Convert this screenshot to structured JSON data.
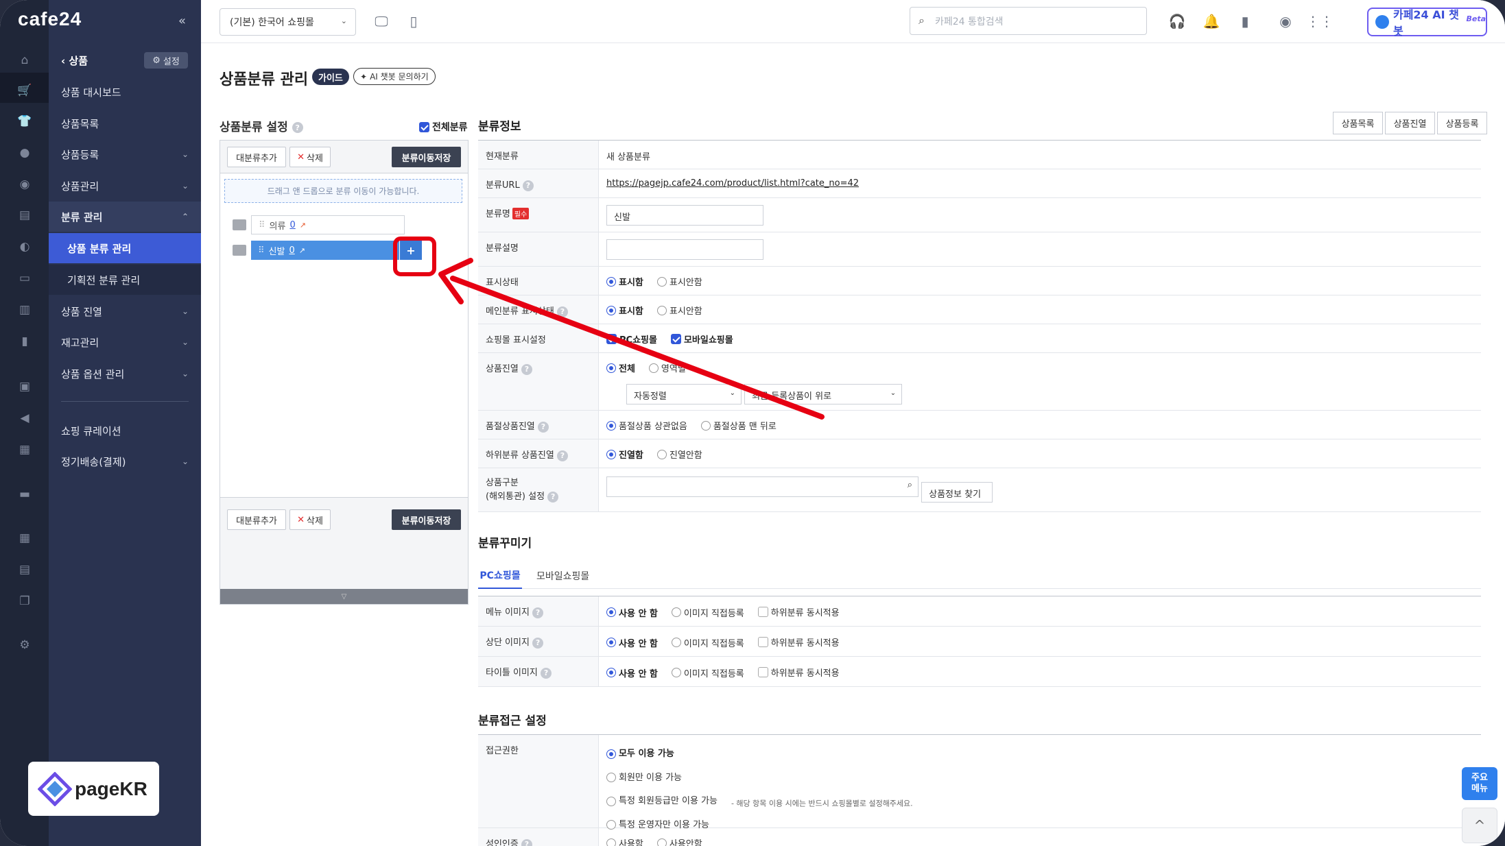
{
  "app": {
    "logo": "cafe24",
    "collapse": "«"
  },
  "rail": {
    "icons": [
      "home-icon",
      "cart-icon",
      "shirt-icon",
      "user-icon",
      "chat-icon",
      "board-icon",
      "palette-icon",
      "coupon-icon",
      "stats-icon",
      "book-icon",
      "store-icon",
      "megaphone-icon",
      "calendar-icon",
      "truck-icon",
      "apps-icon",
      "folder-icon",
      "copy-icon",
      "settings-icon"
    ]
  },
  "sidebar": {
    "back": "상품",
    "settings": "설정",
    "items": [
      {
        "label": "상품 대시보드"
      },
      {
        "label": "상품목록"
      },
      {
        "label": "상품등록"
      },
      {
        "label": "상품관리"
      },
      {
        "label": "분류 관리"
      },
      {
        "label": "상품 분류 관리"
      },
      {
        "label": "기획전 분류 관리"
      },
      {
        "label": "상품 진열"
      },
      {
        "label": "재고관리"
      },
      {
        "label": "상품 옵션 관리"
      },
      {
        "label": "쇼핑 큐레이션"
      },
      {
        "label": "정기배송(결제)"
      }
    ]
  },
  "watermark": {
    "text": "pageKR"
  },
  "header": {
    "mall_select": "(기본) 한국어 쇼핑몰",
    "search_placeholder": "카페24 통합검색",
    "ai_button": "카페24 AI 챗봇",
    "ai_beta": "Beta"
  },
  "page": {
    "title": "상품분류 관리",
    "guide": "가이드",
    "ai_ask": "AI 챗봇 문의하기"
  },
  "left_panel": {
    "title": "상품분류 설정",
    "all_category": "전체분류",
    "add_btn": "대분류추가",
    "del_btn": "삭제",
    "save_btn": "분류이동저장",
    "dnd_hint": "드래그 앤 드롭으로 분류 이동이 가능합니다.",
    "nodes": [
      {
        "name": "의류",
        "count": "0"
      },
      {
        "name": "신발",
        "count": "0"
      }
    ],
    "plus": "+"
  },
  "info": {
    "title": "분류정보",
    "buttons": [
      "상품목록",
      "상품진열",
      "상품등록"
    ],
    "rows": {
      "current_label": "현재분류",
      "current_value": "새 상품분류",
      "url_label": "분류URL",
      "url_value": "https://pagejp.cafe24.com/product/list.html?cate_no=42",
      "name_label": "분류명",
      "required": "필수",
      "name_value": "신발",
      "desc_label": "분류설명",
      "display_label": "표시상태",
      "display_on": "표시함",
      "display_off": "표시안함",
      "main_display_label": "메인분류 표시상태",
      "main_on": "표시함",
      "main_off": "표시안함",
      "shop_label": "쇼핑몰 표시설정",
      "shop_pc": "PC쇼핑몰",
      "shop_mobile": "모바일쇼핑몰",
      "product_display_label": "상품진열",
      "pd_all": "전체",
      "pd_individual": "영역별",
      "sort_auto": "자동정렬",
      "sort_order": "최근 등록상품이 위로",
      "soldout_label": "품절상품진열",
      "soldout_any": "품절상품 상관없음",
      "soldout_last": "품절상품 맨 뒤로",
      "sub_label": "하위분류 상품진열",
      "sub_on": "진열함",
      "sub_off": "진열안함",
      "class_label_1": "상품구분",
      "class_label_2": "(해외통관) 설정",
      "class_btn": "상품정보 찾기"
    }
  },
  "decor": {
    "title": "분류꾸미기",
    "tabs": [
      "PC쇼핑몰",
      "모바일쇼핑몰"
    ],
    "rows": [
      {
        "label": "메뉴 이미지"
      },
      {
        "label": "상단 이미지"
      },
      {
        "label": "타이틀 이미지"
      }
    ],
    "opt_none": "사용 안 함",
    "opt_direct": "이미지 직접등록",
    "opt_sub": "하위분류 동시적용"
  },
  "access": {
    "title": "분류접근 설정",
    "label": "접근권한",
    "opts": [
      "모두 이용 가능",
      "회원만 이용 가능",
      "특정 회원등급만 이용 가능",
      "특정 운영자만 이용 가능"
    ],
    "note": "- 해당 항목 이용 시에는 반드시 쇼핑몰별로 설정해주세요.",
    "adult_label": "성인인증",
    "adult_on": "사용함",
    "adult_off": "사용안함"
  },
  "floating": {
    "main_menu_1": "주요",
    "main_menu_2": "메뉴",
    "top": "^"
  },
  "colors": {
    "accent": "#3157d9",
    "sidebar": "#2a3350",
    "highlight": "#e60012"
  }
}
